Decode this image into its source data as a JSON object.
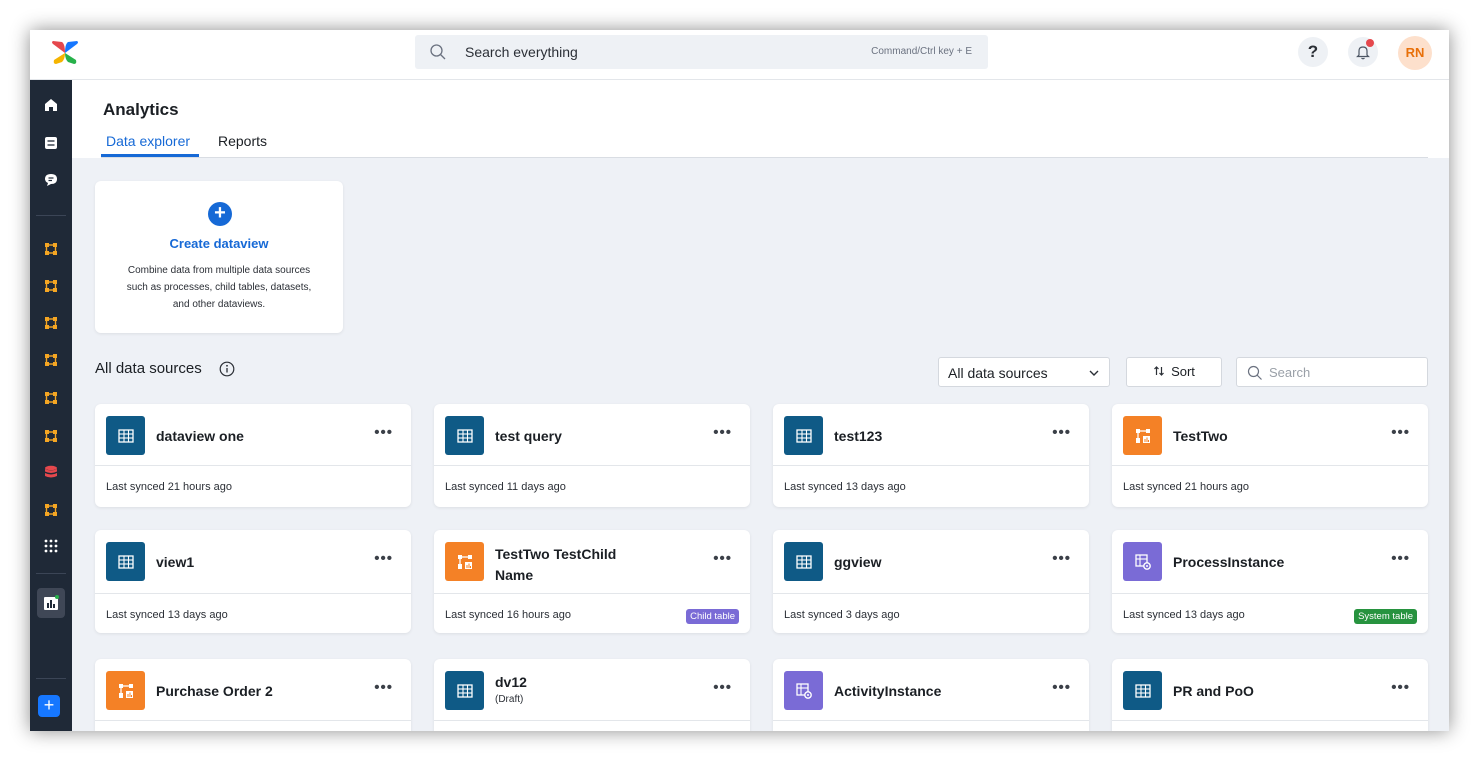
{
  "topbar": {
    "search_placeholder": "Search everything",
    "search_hint": "Command/Ctrl key + E",
    "help_label": "?",
    "avatar_initials": "RN"
  },
  "page": {
    "title": "Analytics",
    "tabs": [
      {
        "label": "Data explorer",
        "active": true
      },
      {
        "label": "Reports",
        "active": false
      }
    ]
  },
  "create_card": {
    "title": "Create dataview",
    "description": "Combine data from multiple data sources such as processes, child tables, datasets, and other dataviews."
  },
  "section": {
    "title": "All data sources",
    "filter_value": "All data sources",
    "sort_label": "Sort",
    "search_placeholder": "Search"
  },
  "cards": [
    {
      "name": "dataview one",
      "type": "table",
      "synced": "Last synced 21 hours ago"
    },
    {
      "name": "test query",
      "type": "table",
      "synced": "Last synced 11 days ago"
    },
    {
      "name": "test123",
      "type": "table",
      "synced": "Last synced 13 days ago"
    },
    {
      "name": "TestTwo",
      "type": "process",
      "synced": "Last synced 21 hours ago"
    },
    {
      "name": "view1",
      "type": "table",
      "synced": "Last synced 13 days ago"
    },
    {
      "name": "TestTwo TestChild Name",
      "type": "process",
      "synced": "Last synced 16 hours ago",
      "badge": "Child table"
    },
    {
      "name": "ggview",
      "type": "table",
      "synced": "Last synced 3 days ago"
    },
    {
      "name": "ProcessInstance",
      "type": "system",
      "synced": "Last synced 13 days ago",
      "badge": "System table"
    },
    {
      "name": "Purchase Order 2",
      "type": "process"
    },
    {
      "name": "dv12",
      "type": "table",
      "sub": "(Draft)"
    },
    {
      "name": "ActivityInstance",
      "type": "system"
    },
    {
      "name": "PR and PoO",
      "type": "table"
    }
  ],
  "colors": {
    "accent": "#1669d6",
    "table_icon": "#0f5a86",
    "process_icon": "#f48126",
    "system_icon": "#7a6bd6",
    "child_badge": "#7a6bd6",
    "system_badge": "#27933f",
    "sidebar": "#1f2937"
  }
}
